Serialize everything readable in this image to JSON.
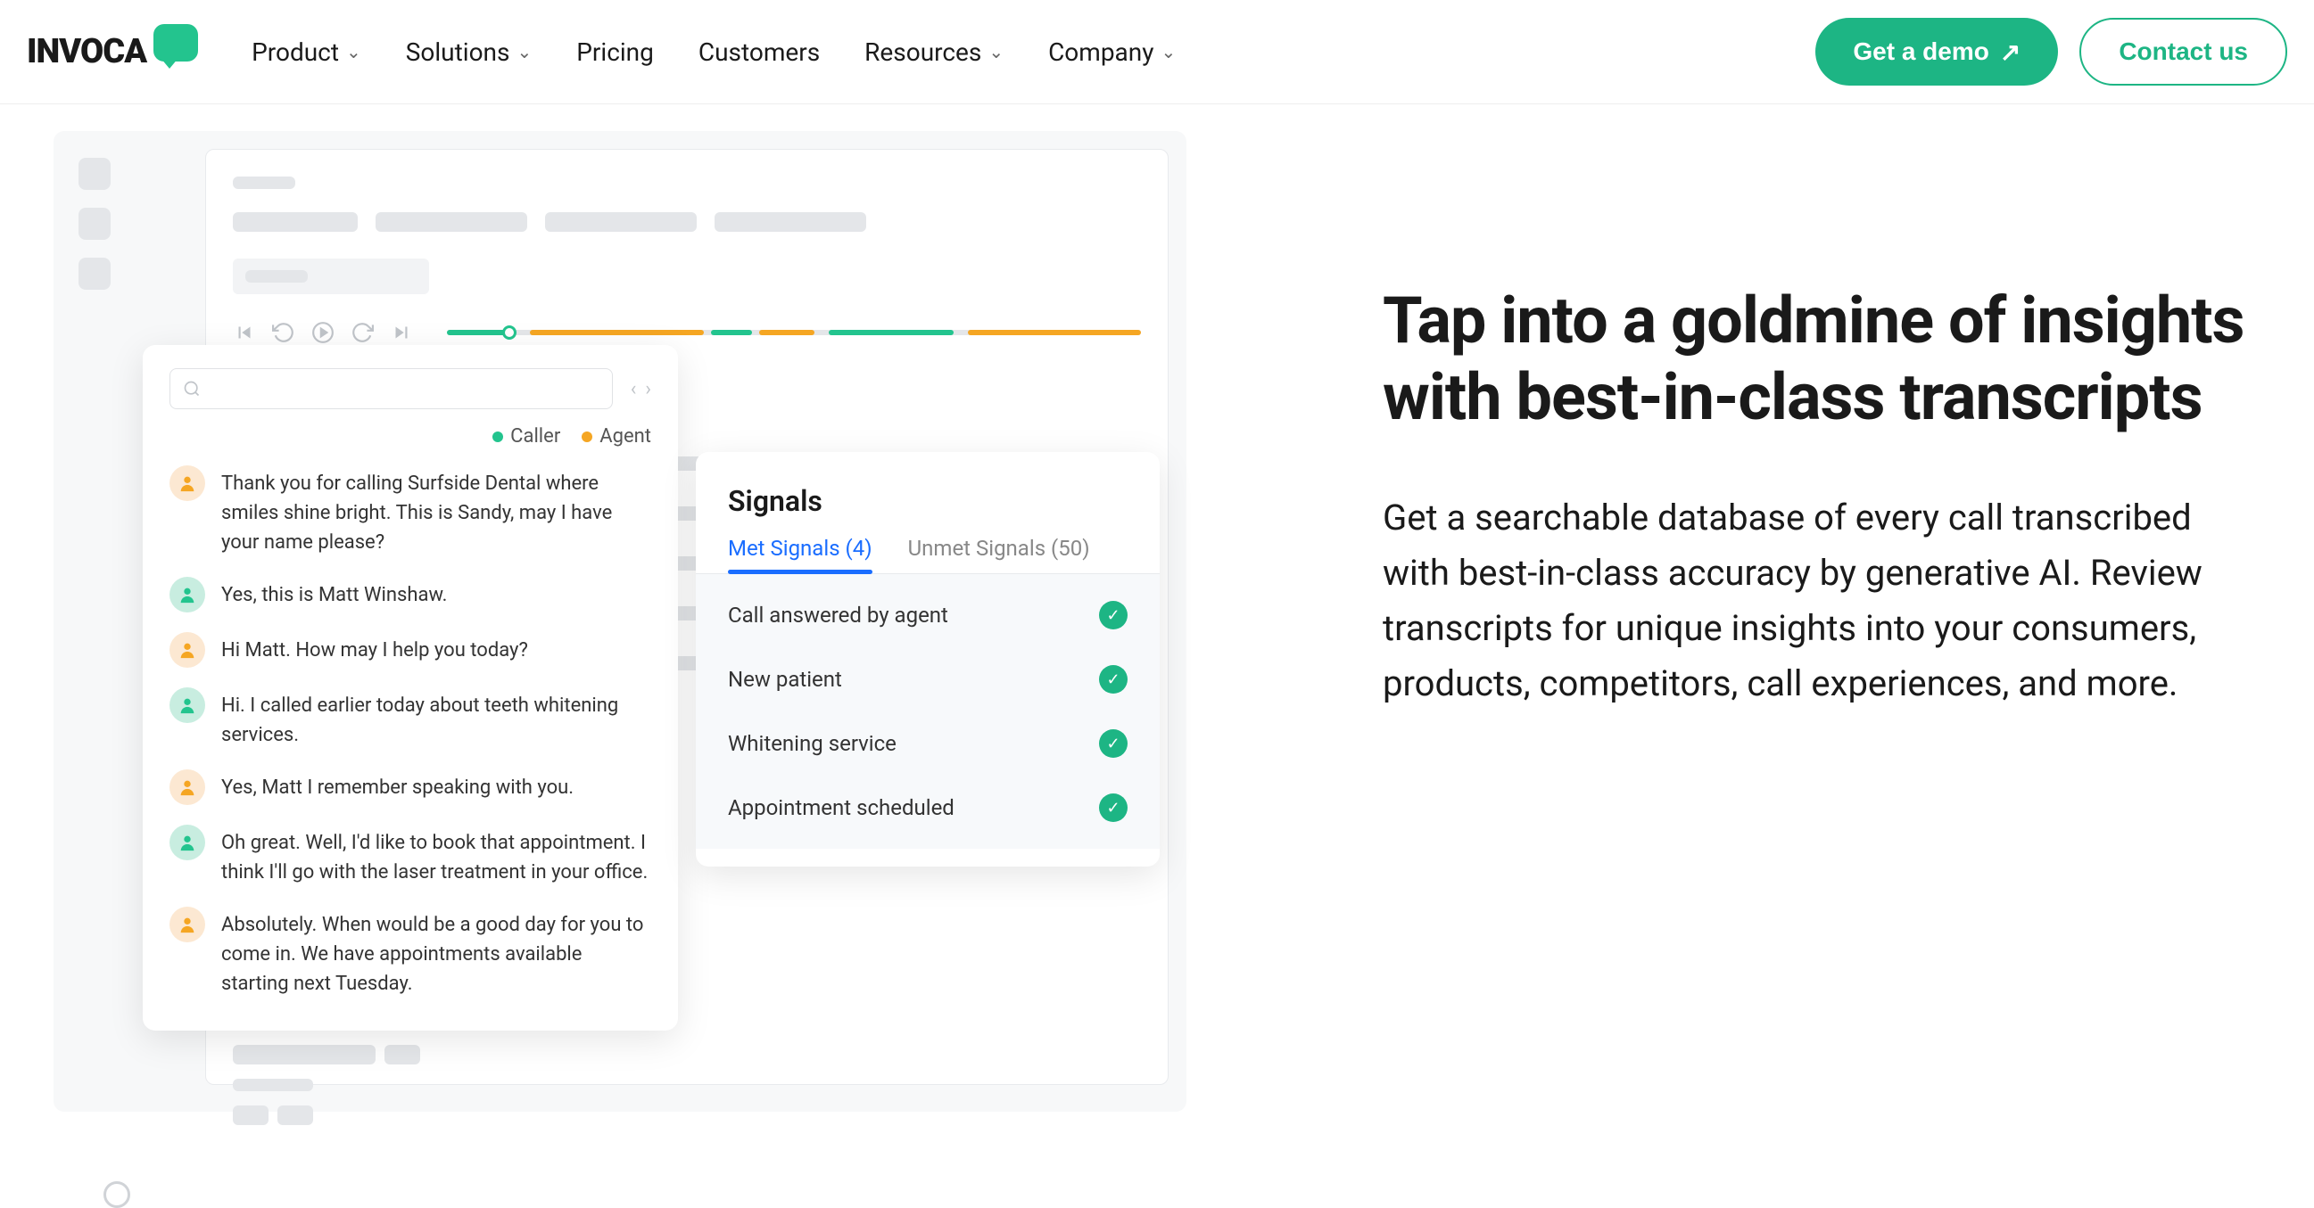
{
  "nav": {
    "links": [
      "Product",
      "Solutions",
      "Pricing",
      "Customers",
      "Resources",
      "Company"
    ],
    "demo": "Get a demo",
    "contact": "Contact us"
  },
  "content": {
    "heading": "Tap into a goldmine of insights with best-in-class transcripts",
    "body": "Get a searchable database of every call transcribed with best-in-class accuracy by generative AI. Review transcripts for unique insights into your consumers, products, competitors, call experiences, and more."
  },
  "transcript": {
    "legend": {
      "caller": "Caller",
      "agent": "Agent"
    },
    "messages": [
      {
        "role": "agent",
        "text": "Thank you for calling Surfside Dental where smiles shine bright. This is Sandy, may I have your name please?"
      },
      {
        "role": "caller",
        "text": "Yes, this is Matt Winshaw."
      },
      {
        "role": "agent",
        "text": " Hi Matt. How may I help you today?"
      },
      {
        "role": "caller",
        "text": "Hi. I called earlier today about teeth whitening services."
      },
      {
        "role": "agent",
        "text": "Yes, Matt I remember speaking with you."
      },
      {
        "role": "caller",
        "text": "Oh great. Well, I'd like to book that appointment. I think I'll go with the laser treatment in your office."
      },
      {
        "role": "agent",
        "text": "Absolutely. When would be a good day for you to come in. We have appointments available starting next Tuesday."
      }
    ]
  },
  "signals": {
    "title": "Signals",
    "tabs": {
      "met": "Met Signals (4)",
      "unmet": "Unmet Signals (50)"
    },
    "items": [
      "Call answered by agent",
      "New patient",
      "Whitening service",
      "Appointment scheduled"
    ]
  }
}
